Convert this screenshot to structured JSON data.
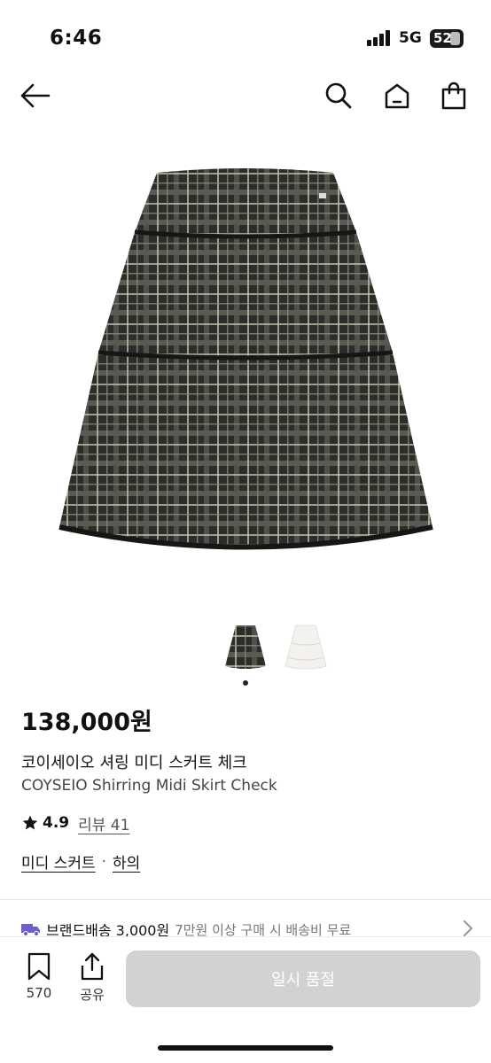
{
  "status_bar": {
    "time": "6:46",
    "network": "5G",
    "battery": "52"
  },
  "nav": {
    "back_icon": "arrow-left-icon",
    "search_icon": "search-icon",
    "home_icon": "home-icon",
    "cart_icon": "shopping-bag-icon"
  },
  "product": {
    "price": "138,000원",
    "name_kr": "코이세이오 셔링 미디 스커트 체크",
    "name_en": "COYSEIO Shirring Midi Skirt Check",
    "rating": "4.9",
    "review_label": "리뷰 41",
    "category_main": "미디 스커트",
    "category_sep": "·",
    "category_sub": "하의"
  },
  "gallery": {
    "thumbnails": [
      "check-skirt",
      "white-skirt"
    ],
    "active_index": 0
  },
  "shipping": {
    "label": "브랜드배송 3,000원",
    "note": "7만원 이상 구매 시 배송비 무료"
  },
  "actions": {
    "like_count": "570",
    "share_label": "공유",
    "cta_label": "일시 품절",
    "cta_color": "#d2d2d2"
  },
  "colors": {
    "accent": "#111111",
    "truck": "#6b5fd0"
  }
}
